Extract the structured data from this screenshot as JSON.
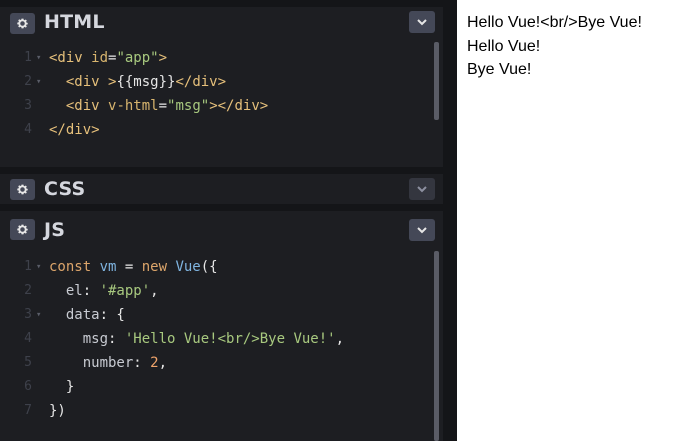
{
  "panels": {
    "html": {
      "title": "HTML"
    },
    "css": {
      "title": "CSS"
    },
    "js": {
      "title": "JS"
    }
  },
  "html_code": {
    "line_numbers": [
      "1",
      "2",
      "3",
      "4"
    ],
    "lines": [
      [
        {
          "t": "<div ",
          "c": "tag"
        },
        {
          "t": "id",
          "c": "attr"
        },
        {
          "t": "=",
          "c": "punc"
        },
        {
          "t": "\"app\"",
          "c": "str"
        },
        {
          "t": ">",
          "c": "tag"
        }
      ],
      [
        {
          "t": "  <div ",
          "c": "tag"
        },
        {
          "t": ">",
          "c": "tag"
        },
        {
          "t": "{{msg}}",
          "c": "txt"
        },
        {
          "t": "</div>",
          "c": "tag"
        }
      ],
      [
        {
          "t": "  <div ",
          "c": "tag"
        },
        {
          "t": "v-html",
          "c": "attr"
        },
        {
          "t": "=",
          "c": "punc"
        },
        {
          "t": "\"msg\"",
          "c": "str"
        },
        {
          "t": "></div>",
          "c": "tag"
        }
      ],
      [
        {
          "t": "</div>",
          "c": "tag"
        }
      ]
    ]
  },
  "js_code": {
    "line_numbers": [
      "1",
      "2",
      "3",
      "4",
      "5",
      "6",
      "7"
    ],
    "lines": [
      [
        {
          "t": "const ",
          "c": "kw"
        },
        {
          "t": "vm",
          "c": "var"
        },
        {
          "t": " = ",
          "c": "punc"
        },
        {
          "t": "new ",
          "c": "kw"
        },
        {
          "t": "Vue",
          "c": "var"
        },
        {
          "t": "({",
          "c": "punc"
        }
      ],
      [
        {
          "t": "  el",
          "c": "prop"
        },
        {
          "t": ": ",
          "c": "punc"
        },
        {
          "t": "'#app'",
          "c": "str"
        },
        {
          "t": ",",
          "c": "punc"
        }
      ],
      [
        {
          "t": "  data",
          "c": "prop"
        },
        {
          "t": ": {",
          "c": "punc"
        }
      ],
      [
        {
          "t": "    msg",
          "c": "prop"
        },
        {
          "t": ": ",
          "c": "punc"
        },
        {
          "t": "'Hello Vue!<br/>Bye Vue!'",
          "c": "str"
        },
        {
          "t": ",",
          "c": "punc"
        }
      ],
      [
        {
          "t": "    number",
          "c": "prop"
        },
        {
          "t": ": ",
          "c": "punc"
        },
        {
          "t": "2",
          "c": "num"
        },
        {
          "t": ",",
          "c": "punc"
        }
      ],
      [
        {
          "t": "  }",
          "c": "punc"
        }
      ],
      [
        {
          "t": "})",
          "c": "punc"
        }
      ]
    ]
  },
  "preview": {
    "lines": [
      "Hello Vue!<br/>Bye Vue!",
      "Hello Vue!",
      "Bye Vue!"
    ]
  },
  "icons": {
    "settings": "gear-icon",
    "collapse": "chevron-down-icon"
  },
  "colors": {
    "editor_bg": "#1d1e22",
    "app_bg": "#141518",
    "button_bg": "#444857"
  }
}
